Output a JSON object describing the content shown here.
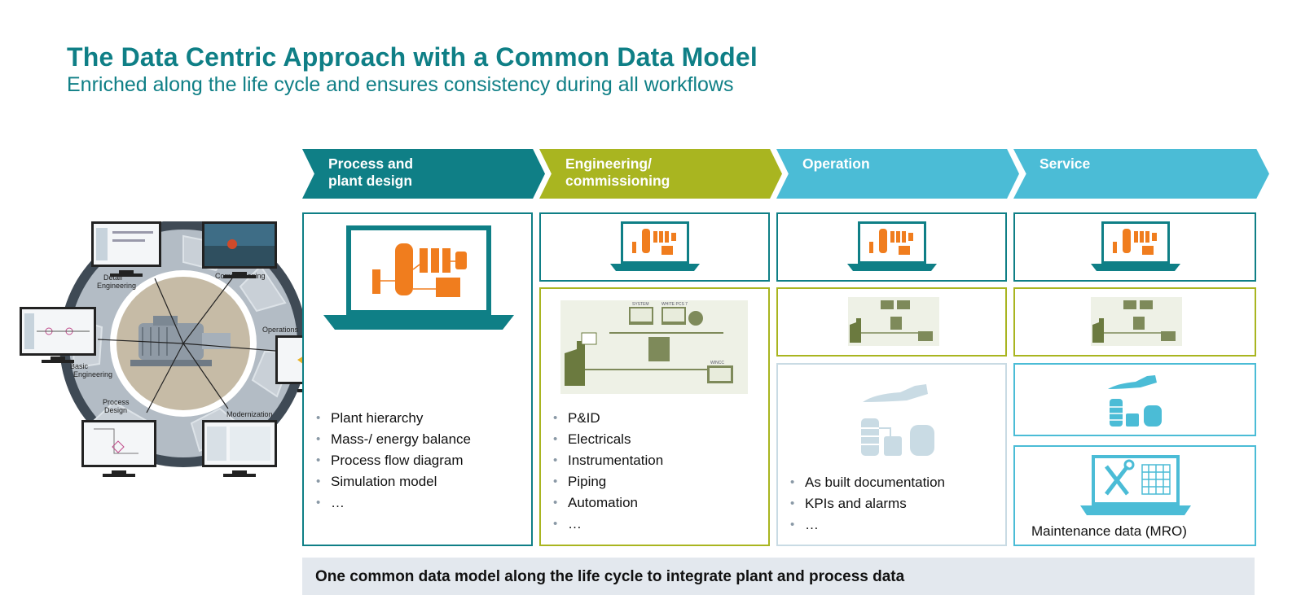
{
  "header": {
    "title": "The Data Centric Approach with a Common Data Model",
    "subtitle": "Enriched along the life cycle and ensures consistency during all workflows"
  },
  "lifecycle": {
    "labels": {
      "detail_engineering": [
        "Detail",
        "Engineering"
      ],
      "commissioning": "Commissioning",
      "operations": "Operations",
      "modernization": "Modernization",
      "process_design": [
        "Process",
        "Design"
      ],
      "basic_engineering": [
        "Basic",
        "Engineering"
      ]
    }
  },
  "phases": [
    {
      "label_line1": "Process and",
      "label_line2": "plant design",
      "color": "#0f7f86"
    },
    {
      "label_line1": "Engineering/",
      "label_line2": "commissioning",
      "color": "#a9b520"
    },
    {
      "label_line1": "Operation",
      "label_line2": "",
      "color": "#4bbcd6"
    },
    {
      "label_line1": "Service",
      "label_line2": "",
      "color": "#4bbcd6"
    }
  ],
  "columns": {
    "process_plant_design": {
      "bullets": [
        "Plant hierarchy",
        "Mass-/ energy balance",
        "Process flow diagram",
        "Simulation model",
        "…"
      ]
    },
    "engineering_commissioning": {
      "bullets": [
        "P&ID",
        "Electricals",
        "Instrumentation",
        "Piping",
        "Automation",
        "…"
      ],
      "mini_labels": [
        "SYSTEM",
        "WHITE PCS 7",
        "WINCC"
      ]
    },
    "operation": {
      "bullets": [
        "As built documentation",
        "KPIs and alarms",
        "…"
      ]
    },
    "service": {
      "maintenance_label": "Maintenance data (MRO)"
    }
  },
  "footer": {
    "text": "One common data model along the life cycle to integrate plant and process data"
  },
  "colors": {
    "teal": "#0f7f86",
    "olive": "#a9b520",
    "light_blue": "#4bbcd6",
    "orange": "#f07d1e",
    "footer_bg": "#e3e8ee"
  }
}
